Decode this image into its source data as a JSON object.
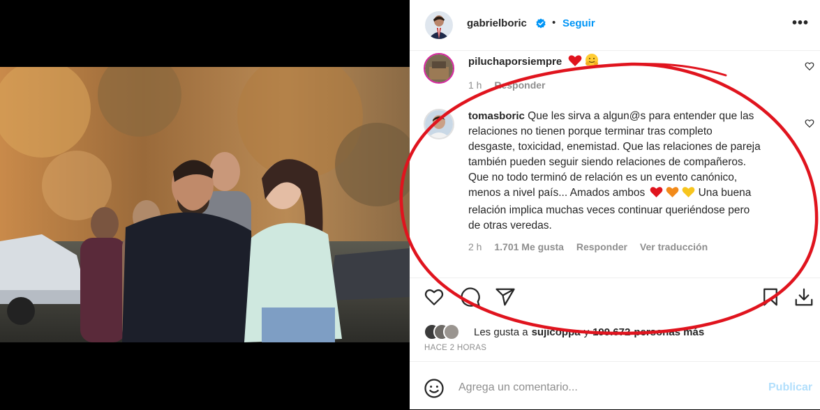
{
  "header": {
    "username": "gabrielboric",
    "separator": "•",
    "follow_label": "Seguir",
    "more_label": "•••"
  },
  "comments": [
    {
      "username": "piluchaporsiempre",
      "text": "",
      "time": "1 h",
      "likes": "",
      "reply_label": "Responder",
      "translate_label": ""
    },
    {
      "username": "tomasboric",
      "text_lines": [
        "Que les sirva a algun@s para entender que las",
        "relaciones no tienen porque terminar tras completo",
        "desgaste, toxicidad, enemistad. Que las relaciones de pareja",
        "también pueden seguir siendo relaciones de compañeros.",
        "Que no todo terminó de relación es un evento canónico,",
        "menos a nivel país... Amados ambos",
        "Una buena",
        "relación implica muchas veces continuar queriéndose pero",
        "de otras veredas."
      ],
      "time": "2 h",
      "likes": "1.701 Me gusta",
      "reply_label": "Responder",
      "translate_label": "Ver traducción"
    }
  ],
  "likes_summary": {
    "prefix": "Les gusta a",
    "user": "sujicoppa",
    "middle": "y",
    "count": "199.672",
    "suffix": "personas más"
  },
  "timestamp": "HACE 2 HORAS",
  "add_comment": {
    "placeholder": "Agrega un comentario...",
    "post_label": "Publicar"
  },
  "colors": {
    "link": "#0095f6",
    "annotation": "#e0141e",
    "muted": "#8e8e8e"
  }
}
